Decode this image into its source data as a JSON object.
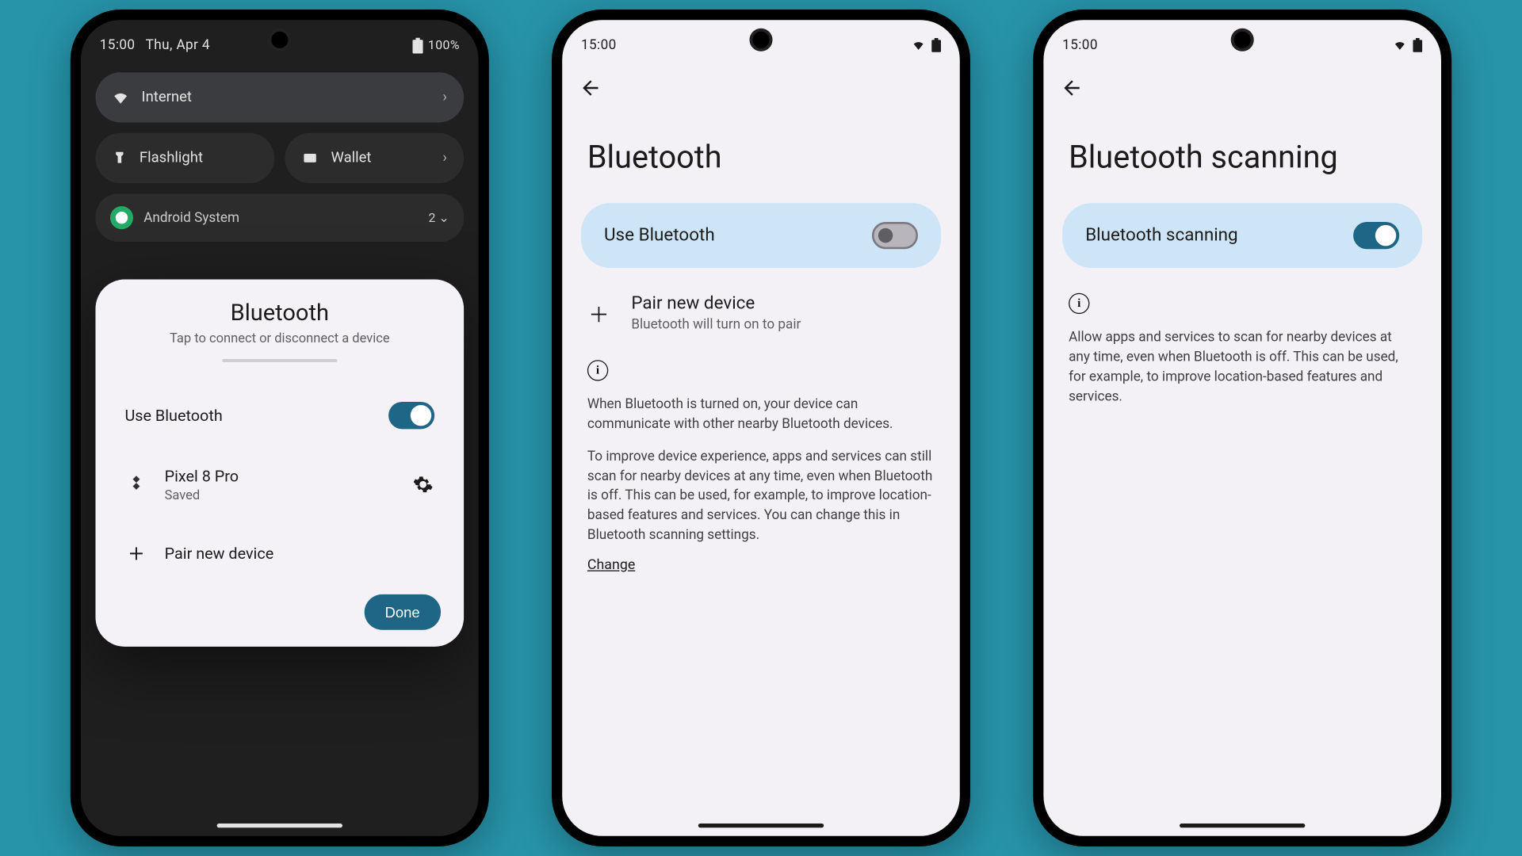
{
  "p1": {
    "status": {
      "time": "15:00",
      "date": "Thu, Apr 4",
      "battery": "100%"
    },
    "qs": {
      "internet": "Internet",
      "flashlight": "Flashlight",
      "wallet": "Wallet"
    },
    "notif": {
      "app": "Android System",
      "count": "2"
    },
    "sheet": {
      "title": "Bluetooth",
      "subtitle": "Tap to connect or disconnect a device",
      "use_bt": "Use Bluetooth",
      "dev_name": "Pixel 8 Pro",
      "dev_status": "Saved",
      "pair": "Pair new device",
      "done": "Done"
    }
  },
  "p2": {
    "status": {
      "time": "15:00"
    },
    "title": "Bluetooth",
    "use_bt": "Use Bluetooth",
    "pair_t": "Pair new device",
    "pair_s": "Bluetooth will turn on to pair",
    "para1": "When Bluetooth is turned on, your device can communicate with other nearby Bluetooth devices.",
    "para2": "To improve device experience, apps and services can still scan for nearby devices at any time, even when Bluetooth is off. This can be used, for example, to improve location-based features and services. You can change this in Bluetooth scanning settings.",
    "change": "Change"
  },
  "p3": {
    "status": {
      "time": "15:00"
    },
    "title": "Bluetooth scanning",
    "toggle_label": "Bluetooth scanning",
    "para": "Allow apps and services to scan for nearby devices at any time, even when Bluetooth is off. This can be used, for example, to improve location-based features and services."
  }
}
